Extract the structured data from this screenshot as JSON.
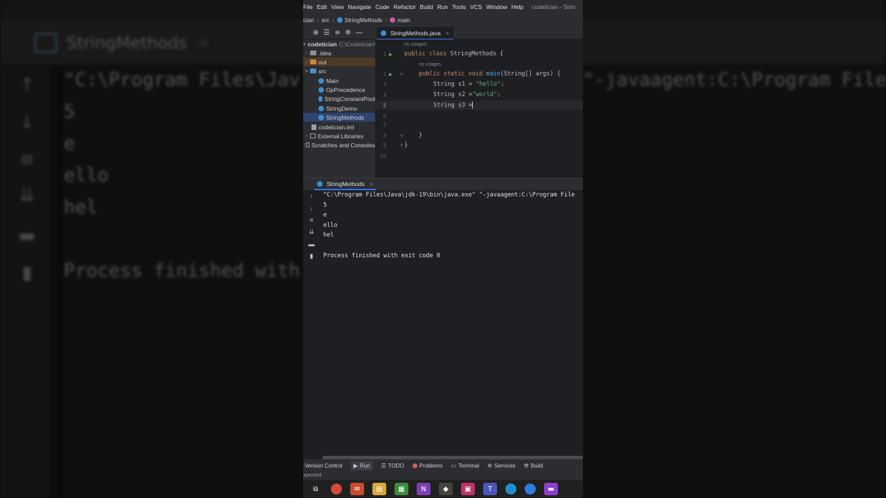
{
  "background": {
    "tab_title": "StringMethods",
    "console_lines": [
      "\"C:\\Program Files\\Jav",
      "5",
      "e",
      "ello",
      "hel",
      "",
      "Process finished with"
    ],
    "right_text": "\"-javaagent:C:\\Program File"
  },
  "menubar": {
    "items": [
      "File",
      "Edit",
      "View",
      "Navigate",
      "Code",
      "Refactor",
      "Build",
      "Run",
      "Tools",
      "VCS",
      "Window",
      "Help"
    ],
    "title": "codetician - Strin"
  },
  "breadcrumb": {
    "items": [
      "cian",
      "src",
      "StringMethods",
      "main"
    ]
  },
  "editor_tab": {
    "label": "StringMethods.java"
  },
  "project": {
    "root": "codetician",
    "root_path": "C:\\Codetician\\",
    "items": [
      ".idea",
      "out",
      "src",
      "Main",
      "OpPrecedence",
      "StringConstantPool",
      "StringDemo",
      "StringMethods",
      "codetician.iml",
      "External Libraries",
      "Scratches and Consoles"
    ]
  },
  "code": {
    "hints": [
      "no usages",
      "no usages"
    ],
    "lines": {
      "l1_kw": "public class ",
      "l1_name": "StringMethods {",
      "l2_kw": "public static void ",
      "l2_fn": "main",
      "l2_rest": "(String[] args) {",
      "l3_type": "String ",
      "l3_var": "s1 = ",
      "l3_str": "\"hello\"",
      "l3_end": ";",
      "l4_type": "String ",
      "l4_var": "s2 =",
      "l4_str": "\"world\"",
      "l4_end": ";",
      "l5_type": "String ",
      "l5_var": "s3 =",
      "l8": "}",
      "l9": "}"
    },
    "line_numbers": [
      "1",
      "2",
      "3",
      "4",
      "5",
      "6",
      "7",
      "8",
      "9",
      "10"
    ]
  },
  "run_tab": {
    "label": "StringMethods"
  },
  "console": {
    "lines": [
      "\"C:\\Program Files\\Java\\jdk-19\\bin\\java.exe\" \"-javaagent:C:\\Program File",
      "5",
      "e",
      "ello",
      "hel",
      "",
      "Process finished with exit code 0"
    ]
  },
  "statusbar": {
    "items": [
      "Version Control",
      "Run",
      "TODO",
      "Problems",
      "Terminal",
      "Services",
      "Build"
    ],
    "message": "xpected"
  },
  "colors": {
    "accent": "#3574f0",
    "keyword": "#cf8e6d",
    "string": "#6aab73",
    "function": "#56a8f5"
  }
}
